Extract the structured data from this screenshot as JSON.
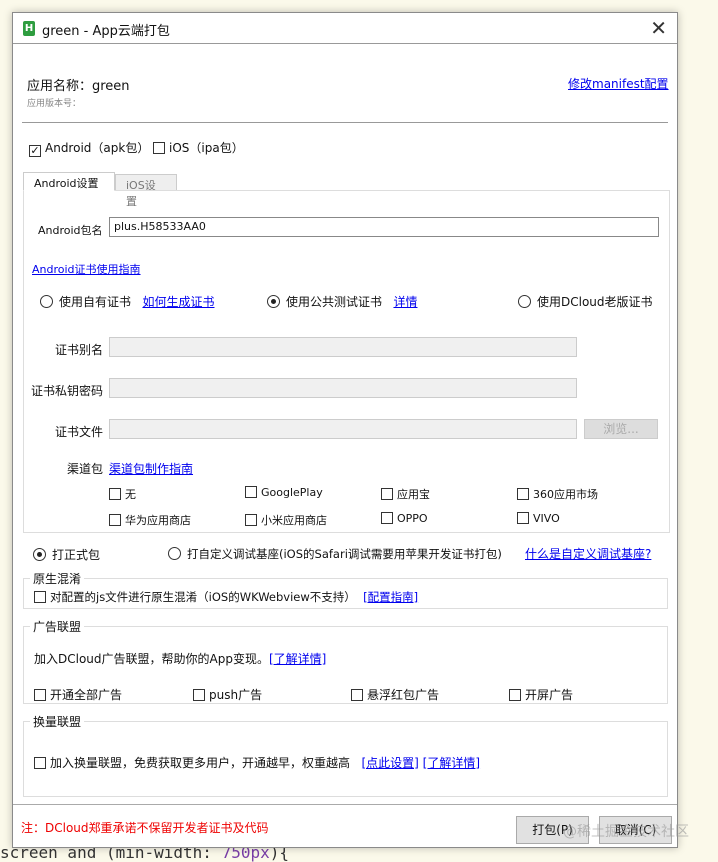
{
  "background": {
    "code_line": "screen and (min-width: ",
    "code_value": "750px",
    "code_tail": "){"
  },
  "window": {
    "title": "green - App云端打包",
    "icon": "H",
    "close_icon": "close-icon"
  },
  "app": {
    "name_label": "应用名称：green",
    "version_label": "应用版本号：",
    "manifest_link": "修改manifest配置"
  },
  "platforms": [
    {
      "label": "Android（apk包）",
      "checked": true
    },
    {
      "label": "iOS（ipa包）",
      "checked": false
    }
  ],
  "tabs": [
    {
      "label": "Android设置",
      "active": true
    },
    {
      "label": "iOS设置",
      "active": false
    }
  ],
  "android": {
    "package_label": "Android包名",
    "package_value": "plus.H58533AA0",
    "cert_guide_link": "Android证书使用指南",
    "cert_options": [
      {
        "label": "使用自有证书",
        "link": "如何生成证书",
        "selected": false
      },
      {
        "label": "使用公共测试证书",
        "link": "详情",
        "selected": true
      },
      {
        "label": "使用DCloud老版证书",
        "selected": false
      }
    ],
    "alias_label": "证书别名",
    "password_label": "证书私钥密码",
    "file_label": "证书文件",
    "browse_label": "浏览...",
    "channel_label": "渠道包",
    "channel_link": "渠道包制作指南",
    "channels": [
      "无",
      "GooglePlay",
      "应用宝",
      "360应用市场",
      "华为应用商店",
      "小米应用商店",
      "OPPO",
      "VIVO"
    ]
  },
  "build_type": [
    {
      "label": "打正式包",
      "selected": true
    },
    {
      "label": "打自定义调试基座(iOS的Safari调试需要用苹果开发证书打包)",
      "selected": false
    }
  ],
  "build_type_link": "什么是自定义调试基座?",
  "obfuscation": {
    "title": "原生混淆",
    "checkbox": "对配置的js文件进行原生混淆（iOS的WKWebview不支持）",
    "link": "[配置指南]"
  },
  "ads": {
    "title": "广告联盟",
    "desc": "加入DCloud广告联盟，帮助你的App变现。",
    "link": "[了解详情]",
    "options": [
      "开通全部广告",
      "push广告",
      "悬浮红包广告",
      "开屏广告"
    ]
  },
  "exchange": {
    "title": "换量联盟",
    "checkbox": "加入换量联盟，免费获取更多用户，开通越早，权重越高",
    "link1": "[点此设置]",
    "link2": "[了解详情]"
  },
  "footer": {
    "note": "注：DCloud郑重承诺不保留开发者证书及代码",
    "pack_button": "打包(P)",
    "cancel_button": "取消(C)",
    "watermark": "@稀土掘金技术社区"
  }
}
